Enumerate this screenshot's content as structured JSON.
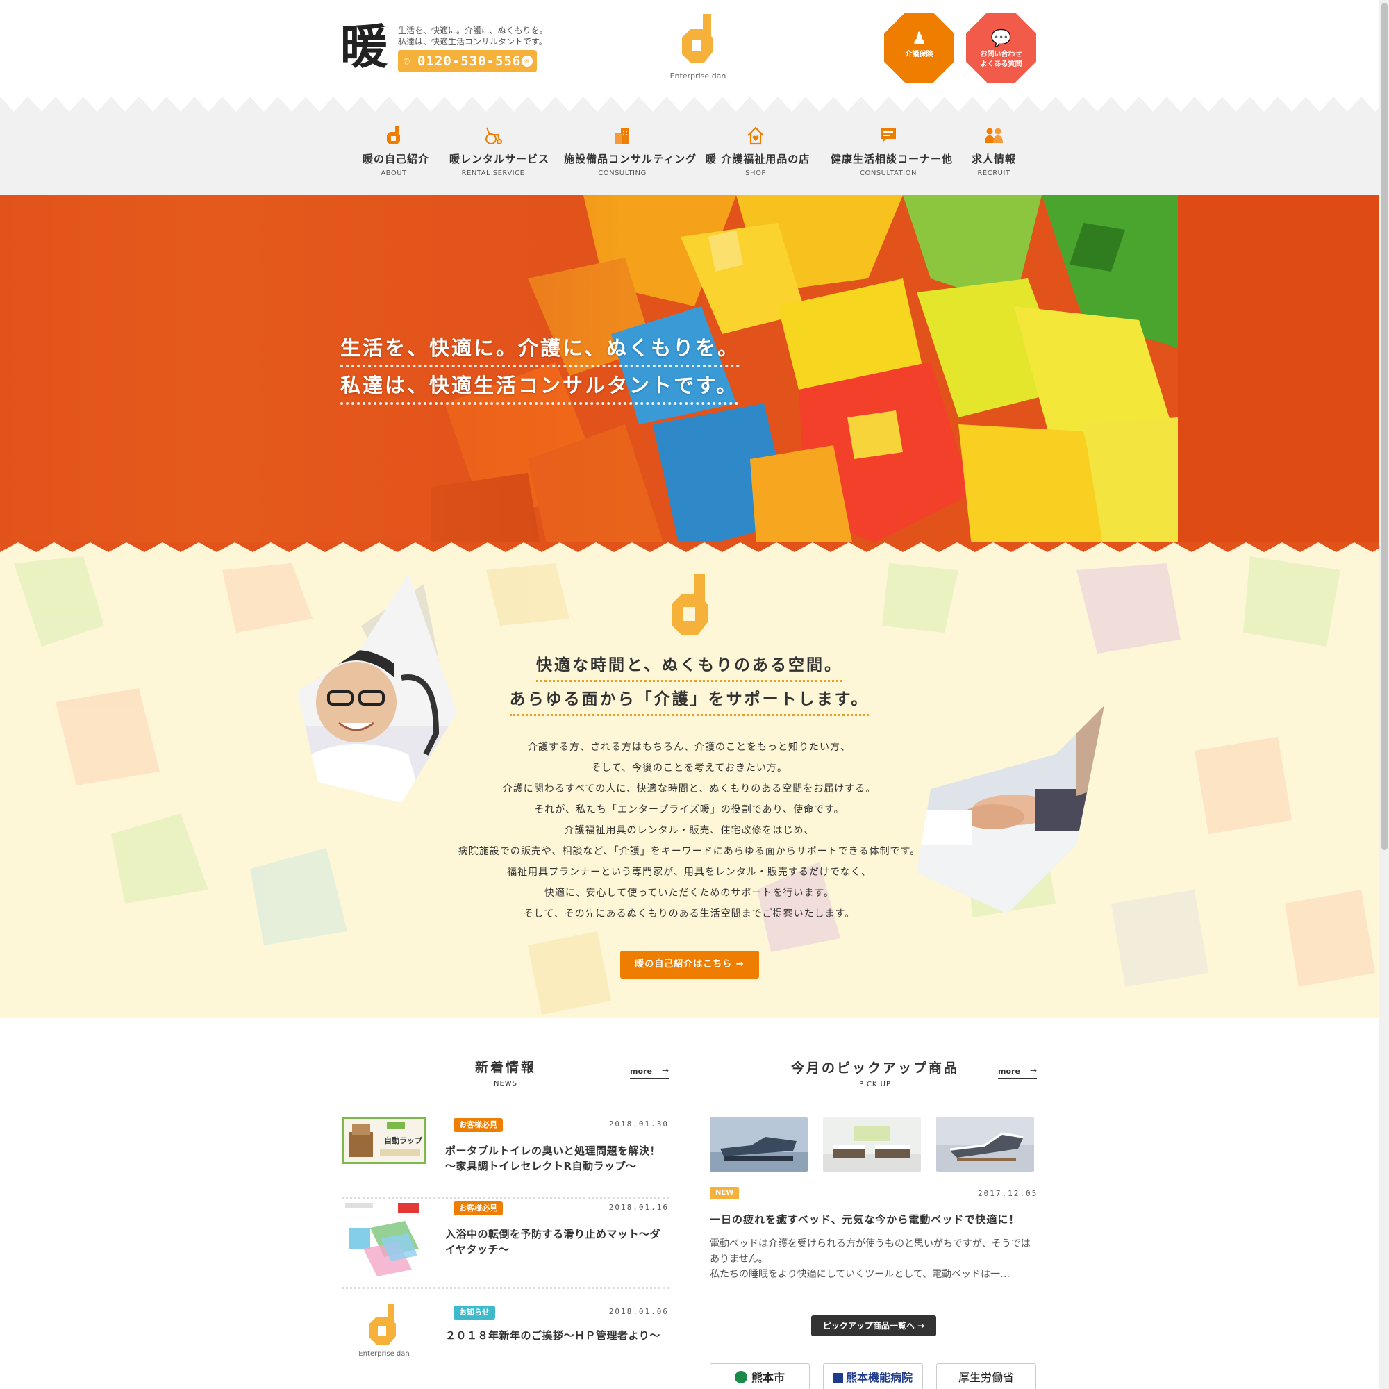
{
  "header": {
    "brand_kanji": "暖",
    "tagline_1": "生活を、快適に。介護に、ぬくもりを。",
    "tagline_2": "私達は、快適生活コンサルタントです。",
    "phone": "0120-530-556",
    "logo_name": "Enterprise dan",
    "care_btn": "介護保険",
    "contact_btn_1": "お問い合わせ",
    "contact_btn_2": "よくある質問"
  },
  "nav": {
    "items": [
      {
        "jp": "暖の自己紹介",
        "en": "ABOUT"
      },
      {
        "jp": "暖レンタルサービス",
        "en": "RENTAL SERVICE"
      },
      {
        "jp": "施設備品コンサルティング",
        "en": "CONSULTING"
      },
      {
        "jp": "暖 介護福祉用品の店",
        "en": "SHOP"
      },
      {
        "jp": "健康生活相談コーナー他",
        "en": "CONSULTATION"
      },
      {
        "jp": "求人情報",
        "en": "RECRUIT"
      }
    ]
  },
  "hero": {
    "line_1": "生活を、快適に。介護に、ぬくもりを。",
    "line_2": "私達は、快適生活コンサルタントです。"
  },
  "about": {
    "heading_1": "快適な時間と、ぬくもりのある空間。",
    "heading_2": "あらゆる面から「介護」をサポートします。",
    "body": [
      "介護する方、される方はもちろん、介護のことをもっと知りたい方、",
      "そして、今後のことを考えておきたい方。",
      "介護に関わるすべての人に、快適な時間と、ぬくもりのある空間をお届けする。",
      "それが、私たち「エンタープライズ暖」の役割であり、使命です。",
      "介護福祉用具のレンタル・販売、住宅改修をはじめ、",
      "病院施設での販売や、相談など、「介護」をキーワードにあらゆる面からサポートできる体制です。",
      "福祉用具プランナーという専門家が、用具をレンタル・販売するだけでなく、",
      "快適に、安心して使っていただくためのサポートを行います。",
      "そして、その先にあるぬくもりのある生活空間までご提案いたします。"
    ],
    "button": "暖の自己紹介はこちら →"
  },
  "news": {
    "title": "新着情報",
    "subtitle": "NEWS",
    "more": "more",
    "items": [
      {
        "badge": "お客様必見",
        "date": "2018.01.30",
        "title": "ポータブルトイレの臭いと処理問題を解決！～家具調トイレセレクトR自動ラップ～",
        "thumb_label": "自動ラップ"
      },
      {
        "badge": "お客様必見",
        "date": "2018.01.16",
        "title": "入浴中の転倒を予防する滑り止めマット～ダイヤタッチ～",
        "thumb_label": ""
      },
      {
        "badge": "お知らせ",
        "date": "2018.01.06",
        "title": "２０１８年新年のご挨拶～ＨＰ管理者より～",
        "thumb_label": "Enterprise dan"
      }
    ]
  },
  "pickup": {
    "title": "今月のピックアップ商品",
    "subtitle": "PICK UP",
    "more": "more",
    "badge": "NEW",
    "date": "2017.12.05",
    "item_title": "一日の疲れを癒すベッド、元気な今から電動ベッドで快適に！",
    "desc_1": "電動ベッドは介護を受けられる方が使うものと思いがちですが、そうではありません。",
    "desc_2": "私たちの睡眠をより快適にしていくツールとして、電動ベッドは一…",
    "list_button": "ピックアップ商品一覧へ →"
  },
  "banners": [
    "熊本市",
    "熊本機能病院",
    "厚生労働省"
  ],
  "colors": {
    "accent_orange": "#ef7d00",
    "accent_yellow": "#f6b13a",
    "accent_red": "#f25a4a",
    "badge_blue": "#3fb9cc",
    "hero_bg": "#e2531b",
    "about_bg": "#fdf7d8"
  }
}
